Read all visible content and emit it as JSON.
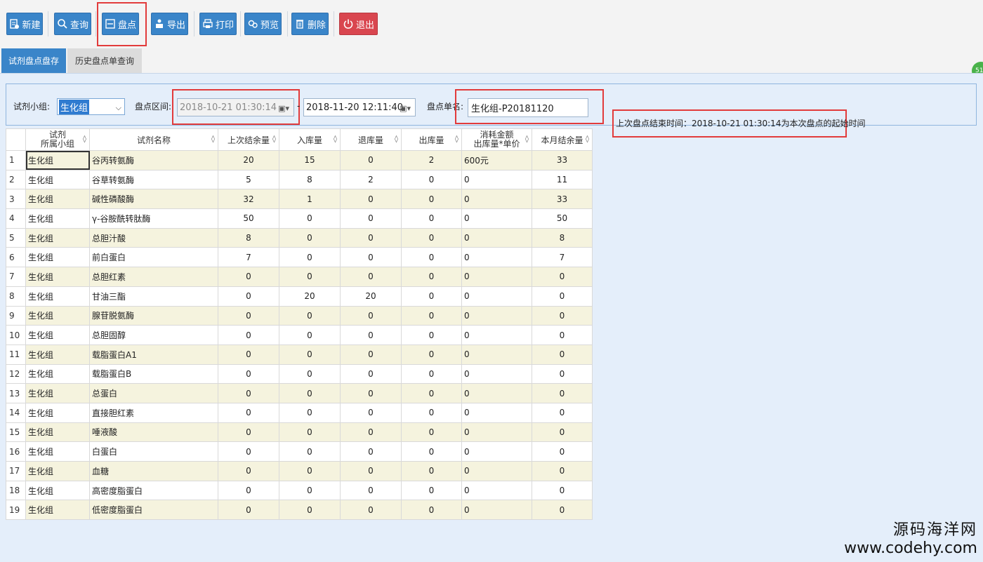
{
  "toolbar": {
    "new_label": "新建",
    "query_label": "查询",
    "inventory_label": "盘点",
    "export_label": "导出",
    "print_label": "打印",
    "preview_label": "预览",
    "delete_label": "删除",
    "exit_label": "退出"
  },
  "tabs": {
    "current": "试剂盘点盘存",
    "history": "历史盘点单查询"
  },
  "filter": {
    "group_label": "试剂小组:",
    "group_value": "生化组",
    "range_label": "盘点区间:",
    "range_start": "2018-10-21 01:30:14",
    "range_sep": "-",
    "range_end": "2018-11-20 12:11:40",
    "order_label": "盘点单名:",
    "order_value": "生化组-P20181120",
    "last_end_note": "上次盘点结束时间：2018-10-21 01:30:14为本次盘点的起始时间"
  },
  "grid": {
    "headers": {
      "group_line1": "试剂",
      "group_line2": "所属小组",
      "name": "试剂名称",
      "last_balance": "上次结余量",
      "inbound": "入库量",
      "returned": "退库量",
      "outbound": "出库量",
      "cost_line1": "消耗金额",
      "cost_line2": "出库量*单价",
      "month_balance": "本月结余量",
      "sort_icon": "◊"
    },
    "rows": [
      {
        "n": "1",
        "group": "生化组",
        "name": "谷丙转氨酶",
        "last": "20",
        "in": "15",
        "ret": "0",
        "out": "2",
        "cost": "600元",
        "bal": "33"
      },
      {
        "n": "2",
        "group": "生化组",
        "name": "谷草转氨酶",
        "last": "5",
        "in": "8",
        "ret": "2",
        "out": "0",
        "cost": "0",
        "bal": "11"
      },
      {
        "n": "3",
        "group": "生化组",
        "name": "碱性磷酸酶",
        "last": "32",
        "in": "1",
        "ret": "0",
        "out": "0",
        "cost": "0",
        "bal": "33"
      },
      {
        "n": "4",
        "group": "生化组",
        "name": "γ-谷胺酰转肽酶",
        "last": "50",
        "in": "0",
        "ret": "0",
        "out": "0",
        "cost": "0",
        "bal": "50"
      },
      {
        "n": "5",
        "group": "生化组",
        "name": "总胆汁酸",
        "last": "8",
        "in": "0",
        "ret": "0",
        "out": "0",
        "cost": "0",
        "bal": "8"
      },
      {
        "n": "6",
        "group": "生化组",
        "name": "前白蛋白",
        "last": "7",
        "in": "0",
        "ret": "0",
        "out": "0",
        "cost": "0",
        "bal": "7"
      },
      {
        "n": "7",
        "group": "生化组",
        "name": "总胆红素",
        "last": "0",
        "in": "0",
        "ret": "0",
        "out": "0",
        "cost": "0",
        "bal": "0"
      },
      {
        "n": "8",
        "group": "生化组",
        "name": "甘油三酯",
        "last": "0",
        "in": "20",
        "ret": "20",
        "out": "0",
        "cost": "0",
        "bal": "0"
      },
      {
        "n": "9",
        "group": "生化组",
        "name": "腺苷脱氨酶",
        "last": "0",
        "in": "0",
        "ret": "0",
        "out": "0",
        "cost": "0",
        "bal": "0"
      },
      {
        "n": "10",
        "group": "生化组",
        "name": "总胆固醇",
        "last": "0",
        "in": "0",
        "ret": "0",
        "out": "0",
        "cost": "0",
        "bal": "0"
      },
      {
        "n": "11",
        "group": "生化组",
        "name": "载脂蛋白A1",
        "last": "0",
        "in": "0",
        "ret": "0",
        "out": "0",
        "cost": "0",
        "bal": "0"
      },
      {
        "n": "12",
        "group": "生化组",
        "name": "载脂蛋白B",
        "last": "0",
        "in": "0",
        "ret": "0",
        "out": "0",
        "cost": "0",
        "bal": "0"
      },
      {
        "n": "13",
        "group": "生化组",
        "name": "总蛋白",
        "last": "0",
        "in": "0",
        "ret": "0",
        "out": "0",
        "cost": "0",
        "bal": "0"
      },
      {
        "n": "14",
        "group": "生化组",
        "name": "直接胆红素",
        "last": "0",
        "in": "0",
        "ret": "0",
        "out": "0",
        "cost": "0",
        "bal": "0"
      },
      {
        "n": "15",
        "group": "生化组",
        "name": "唾液酸",
        "last": "0",
        "in": "0",
        "ret": "0",
        "out": "0",
        "cost": "0",
        "bal": "0"
      },
      {
        "n": "16",
        "group": "生化组",
        "name": "白蛋白",
        "last": "0",
        "in": "0",
        "ret": "0",
        "out": "0",
        "cost": "0",
        "bal": "0"
      },
      {
        "n": "17",
        "group": "生化组",
        "name": "血糖",
        "last": "0",
        "in": "0",
        "ret": "0",
        "out": "0",
        "cost": "0",
        "bal": "0"
      },
      {
        "n": "18",
        "group": "生化组",
        "name": "高密度脂蛋白",
        "last": "0",
        "in": "0",
        "ret": "0",
        "out": "0",
        "cost": "0",
        "bal": "0"
      },
      {
        "n": "19",
        "group": "生化组",
        "name": "低密度脂蛋白",
        "last": "0",
        "in": "0",
        "ret": "0",
        "out": "0",
        "cost": "0",
        "bal": "0"
      }
    ]
  },
  "watermark": {
    "line1": "源码海洋网",
    "line2": "www.codehy.com"
  },
  "edge_badge": "51"
}
